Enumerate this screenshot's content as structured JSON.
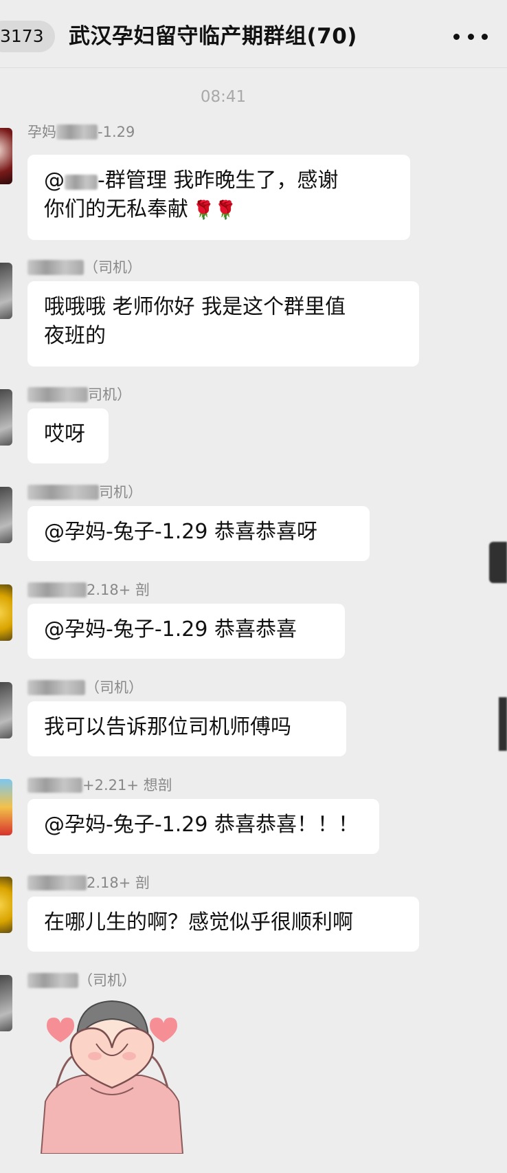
{
  "header": {
    "back_count": "3173",
    "title": "武汉孕妇留守临产期群组(70)"
  },
  "timestamp": "08:41",
  "messages": [
    {
      "sender_suffix": "-1.29",
      "sender_prefix": "孕妈",
      "text_prefix": "@",
      "text_main": "-群管理 我昨晚生了，感谢",
      "text_line2": "你们的无私奉献",
      "emoji": "🌹🌹"
    },
    {
      "sender_suffix": "（司机）",
      "text": "哦哦哦  老师你好  我是这个群里值",
      "text_line2": "夜班的"
    },
    {
      "sender_suffix": "司机）",
      "text": "哎呀"
    },
    {
      "sender_suffix": "司机）",
      "text": "@孕妈-兔子-1.29 恭喜恭喜呀"
    },
    {
      "sender_suffix": "2.18+ 剖",
      "text": "@孕妈-兔子-1.29 恭喜恭喜"
    },
    {
      "sender_suffix": "（司机）",
      "text": "我可以告诉那位司机师傅吗"
    },
    {
      "sender_suffix": "+2.21+ 想剖",
      "text": "@孕妈-兔子-1.29 恭喜恭喜！！！"
    },
    {
      "sender_suffix": "2.18+ 剖",
      "text": "在哪儿生的啊？感觉似乎很顺利啊"
    },
    {
      "sender_suffix": "（司机）",
      "sticker": "heart-hands-sticker"
    }
  ]
}
